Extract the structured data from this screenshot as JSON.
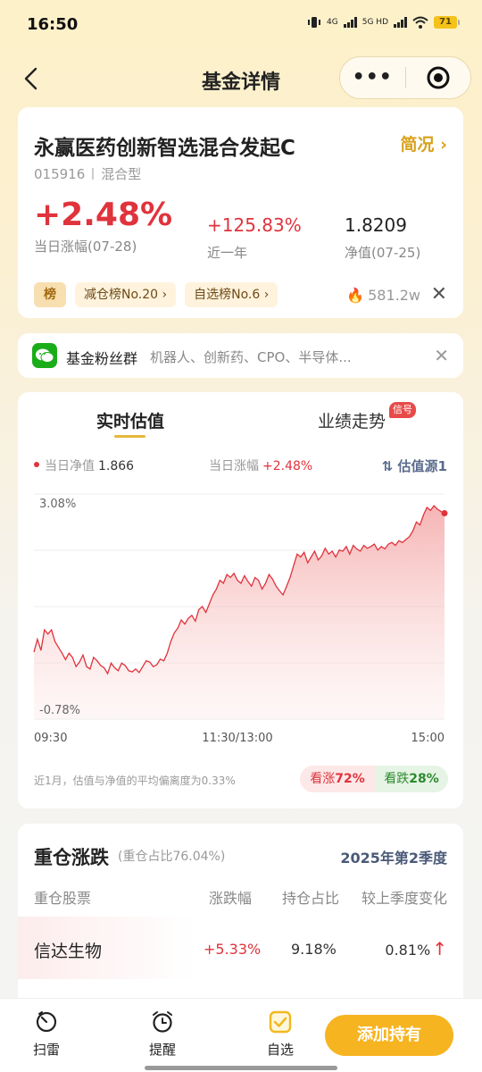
{
  "status_bar": {
    "time": "16:50",
    "network1": "4G",
    "network2": "5G HD",
    "battery": "71"
  },
  "nav": {
    "title": "基金详情",
    "more_icon": "more-dots-icon",
    "target_icon": "target-icon"
  },
  "fund": {
    "name": "永赢医药创新智选混合发起C",
    "summary_link": "简况",
    "code": "015916",
    "type": "混合型",
    "day_change": "+2.48%",
    "day_change_label": "当日涨幅(07-28)",
    "year_change": "+125.83%",
    "year_change_label": "近一年",
    "nav": "1.8209",
    "nav_label": "净值(07-25)",
    "rank_icon_text": "榜",
    "tags": [
      "减仓榜No.20 ›",
      "自选榜No.6 ›"
    ],
    "hot": "581.2w"
  },
  "fan_group": {
    "name": "基金粉丝群",
    "topics": "机器人、创新药、CPO、半导体..."
  },
  "chart_section": {
    "tab_active": "实时估值",
    "tab_other": "业绩走势",
    "badge": "信号",
    "nav_label": "当日净值",
    "nav_value": "1.866",
    "change_label": "当日涨幅",
    "change_value": "+2.48%",
    "source": "⇅ 估值源1",
    "deviation_note": "近1月，估值与净值的平均偏离度为0.33%",
    "vote_up_label": "看涨",
    "vote_up_value": "72%",
    "vote_down_label": "看跌",
    "vote_down_value": "28%"
  },
  "chart_data": {
    "type": "area",
    "ymax_label": "3.08%",
    "ymin_label": "-0.78%",
    "ylim": [
      -0.78,
      3.08
    ],
    "x_labels": [
      "09:30",
      "11:30/13:00",
      "15:00"
    ],
    "color": "#e0333c",
    "values": [
      0.37,
      0.59,
      0.4,
      0.75,
      0.68,
      0.75,
      0.55,
      0.45,
      0.35,
      0.24,
      0.35,
      0.28,
      0.12,
      0.2,
      0.32,
      0.12,
      0.08,
      0.28,
      0.22,
      0.14,
      0.1,
      0.0,
      0.18,
      0.1,
      0.05,
      0.18,
      0.14,
      0.05,
      0.03,
      0.08,
      0.02,
      0.12,
      0.22,
      0.2,
      0.12,
      0.15,
      0.25,
      0.22,
      0.35,
      0.55,
      0.7,
      0.78,
      0.92,
      0.85,
      0.95,
      1.0,
      0.9,
      1.1,
      1.15,
      1.05,
      1.2,
      1.35,
      1.45,
      1.6,
      1.55,
      1.7,
      1.65,
      1.72,
      1.6,
      1.55,
      1.68,
      1.58,
      1.5,
      1.65,
      1.6,
      1.45,
      1.55,
      1.7,
      1.62,
      1.5,
      1.42,
      1.35,
      1.5,
      1.65,
      1.85,
      2.05,
      2.0,
      2.08,
      1.9,
      2.0,
      2.1,
      1.95,
      2.02,
      2.15,
      2.05,
      2.1,
      2.0,
      2.12,
      2.1,
      2.18,
      2.05,
      2.2,
      2.14,
      2.1,
      2.2,
      2.15,
      2.18,
      2.22,
      2.12,
      2.18,
      2.14,
      2.22,
      2.25,
      2.2,
      2.28,
      2.25,
      2.3,
      2.35,
      2.45,
      2.6,
      2.55,
      2.72,
      2.85,
      2.8,
      2.88,
      2.82,
      2.78,
      2.75
    ],
    "end_value": 2.48
  },
  "holdings": {
    "title": "重仓涨跌",
    "subtitle": "(重仓占比76.04%)",
    "quarter": "2025年第2季度",
    "headers": [
      "重仓股票",
      "涨跌幅",
      "持仓占比",
      "较上季度变化"
    ],
    "rows": [
      {
        "name": "信达生物",
        "change": "+5.33%",
        "weight": "9.18%",
        "delta": "0.81%"
      }
    ]
  },
  "bottom_bar": {
    "item1": "扫雷",
    "item2": "提醒",
    "item3": "自选",
    "add_button": "添加持有"
  }
}
